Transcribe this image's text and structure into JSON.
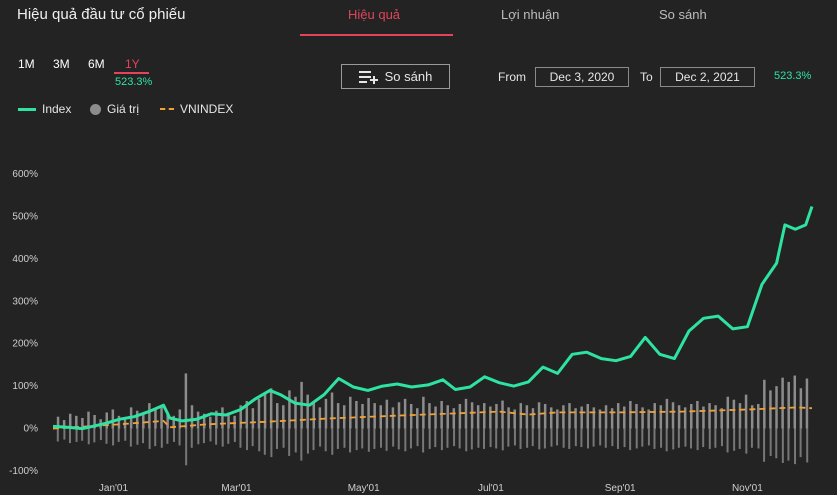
{
  "title": "Hiệu quả đầu tư cổ phiếu",
  "tabs": [
    {
      "label": "Hiệu quả",
      "active": true
    },
    {
      "label": "Lợi nhuận",
      "active": false
    },
    {
      "label": "So sánh",
      "active": false
    }
  ],
  "periods": [
    {
      "label": "1M",
      "active": false
    },
    {
      "label": "3M",
      "active": false
    },
    {
      "label": "6M",
      "active": false
    },
    {
      "label": "1Y",
      "active": true
    }
  ],
  "period_return": "523.3%",
  "compare_button": {
    "label": "So sánh",
    "icon": "playlist-add-icon"
  },
  "range": {
    "from_label": "From",
    "from": "Dec 3, 2020",
    "to_label": "To",
    "to": "Dec 2, 2021",
    "return": "523.3%"
  },
  "legend": [
    {
      "label": "Index",
      "color": "#2ee3a2",
      "shape": "line"
    },
    {
      "label": "Giá trị",
      "color": "#8c8c8c",
      "shape": "circle"
    },
    {
      "label": "VNINDEX",
      "color": "#f2a134",
      "shape": "dash"
    }
  ],
  "colors": {
    "index": "#2ee3a2",
    "volume": "#8c8c8c",
    "vnindex": "#f2a134",
    "accent": "#e0455a"
  },
  "chart_data": {
    "type": "line",
    "y_ticks": [
      "600%",
      "500%",
      "400%",
      "300%",
      "200%",
      "100%",
      "0%",
      "-100%"
    ],
    "ylim": [
      -100,
      600
    ],
    "x_ticks": [
      {
        "label": "Jan'01",
        "date": "2021-01-01"
      },
      {
        "label": "Mar'01",
        "date": "2021-03-01"
      },
      {
        "label": "May'01",
        "date": "2021-05-01"
      },
      {
        "label": "Jul'01",
        "date": "2021-07-01"
      },
      {
        "label": "Sep'01",
        "date": "2021-09-01"
      },
      {
        "label": "Nov'01",
        "date": "2021-11-01"
      }
    ],
    "xlim": [
      "2020-12-03",
      "2021-12-02"
    ],
    "series": [
      {
        "name": "Index",
        "points": [
          [
            "2020-12-03",
            5
          ],
          [
            "2020-12-10",
            3
          ],
          [
            "2020-12-17",
            0
          ],
          [
            "2020-12-22",
            5
          ],
          [
            "2020-12-28",
            12
          ],
          [
            "2021-01-04",
            22
          ],
          [
            "2021-01-11",
            28
          ],
          [
            "2021-01-18",
            40
          ],
          [
            "2021-01-25",
            55
          ],
          [
            "2021-01-28",
            25
          ],
          [
            "2021-02-03",
            18
          ],
          [
            "2021-02-10",
            22
          ],
          [
            "2021-02-17",
            35
          ],
          [
            "2021-02-24",
            32
          ],
          [
            "2021-03-03",
            45
          ],
          [
            "2021-03-10",
            70
          ],
          [
            "2021-03-17",
            90
          ],
          [
            "2021-03-22",
            80
          ],
          [
            "2021-03-29",
            60
          ],
          [
            "2021-04-05",
            55
          ],
          [
            "2021-04-12",
            80
          ],
          [
            "2021-04-19",
            118
          ],
          [
            "2021-04-26",
            98
          ],
          [
            "2021-05-03",
            90
          ],
          [
            "2021-05-10",
            100
          ],
          [
            "2021-05-17",
            105
          ],
          [
            "2021-05-24",
            98
          ],
          [
            "2021-06-01",
            103
          ],
          [
            "2021-06-08",
            115
          ],
          [
            "2021-06-14",
            92
          ],
          [
            "2021-06-21",
            98
          ],
          [
            "2021-06-28",
            122
          ],
          [
            "2021-07-05",
            108
          ],
          [
            "2021-07-12",
            100
          ],
          [
            "2021-07-19",
            110
          ],
          [
            "2021-07-26",
            145
          ],
          [
            "2021-08-02",
            130
          ],
          [
            "2021-08-09",
            175
          ],
          [
            "2021-08-16",
            180
          ],
          [
            "2021-08-23",
            165
          ],
          [
            "2021-08-30",
            160
          ],
          [
            "2021-09-06",
            170
          ],
          [
            "2021-09-13",
            215
          ],
          [
            "2021-09-20",
            175
          ],
          [
            "2021-09-27",
            165
          ],
          [
            "2021-10-04",
            230
          ],
          [
            "2021-10-11",
            260
          ],
          [
            "2021-10-18",
            265
          ],
          [
            "2021-10-25",
            235
          ],
          [
            "2021-11-01",
            240
          ],
          [
            "2021-11-08",
            340
          ],
          [
            "2021-11-15",
            390
          ],
          [
            "2021-11-19",
            480
          ],
          [
            "2021-11-24",
            470
          ],
          [
            "2021-11-29",
            480
          ],
          [
            "2021-12-02",
            523.3
          ]
        ]
      },
      {
        "name": "VNINDEX",
        "points": [
          [
            "2020-12-03",
            0
          ],
          [
            "2021-01-04",
            10
          ],
          [
            "2021-01-25",
            18
          ],
          [
            "2021-01-28",
            3
          ],
          [
            "2021-02-15",
            10
          ],
          [
            "2021-03-15",
            16
          ],
          [
            "2021-04-15",
            24
          ],
          [
            "2021-05-15",
            30
          ],
          [
            "2021-06-15",
            36
          ],
          [
            "2021-07-05",
            40
          ],
          [
            "2021-07-19",
            33
          ],
          [
            "2021-08-02",
            38
          ],
          [
            "2021-09-01",
            38
          ],
          [
            "2021-10-01",
            40
          ],
          [
            "2021-11-01",
            45
          ],
          [
            "2021-11-25",
            50
          ],
          [
            "2021-12-02",
            48
          ]
        ]
      },
      {
        "name": "Giá trị",
        "values": [
          28,
          20,
          35,
          30,
          25,
          40,
          32,
          22,
          38,
          45,
          30,
          25,
          50,
          42,
          35,
          60,
          48,
          55,
          38,
          30,
          45,
          130,
          55,
          40,
          35,
          28,
          42,
          50,
          38,
          30,
          55,
          65,
          48,
          70,
          85,
          95,
          60,
          55,
          90,
          75,
          110,
          80,
          65,
          50,
          70,
          85,
          60,
          55,
          75,
          65,
          58,
          72,
          60,
          55,
          68,
          50,
          62,
          70,
          58,
          48,
          75,
          60,
          52,
          65,
          55,
          48,
          58,
          70,
          62,
          55,
          60,
          52,
          58,
          66,
          50,
          45,
          60,
          55,
          48,
          62,
          58,
          50,
          45,
          55,
          60,
          48,
          52,
          58,
          50,
          45,
          55,
          48,
          60,
          52,
          65,
          58,
          50,
          45,
          60,
          55,
          70,
          62,
          55,
          50,
          58,
          65,
          52,
          60,
          55,
          48,
          75,
          68,
          60,
          80,
          55,
          58,
          115,
          90,
          100,
          120,
          110,
          125,
          95,
          118
        ]
      }
    ]
  }
}
